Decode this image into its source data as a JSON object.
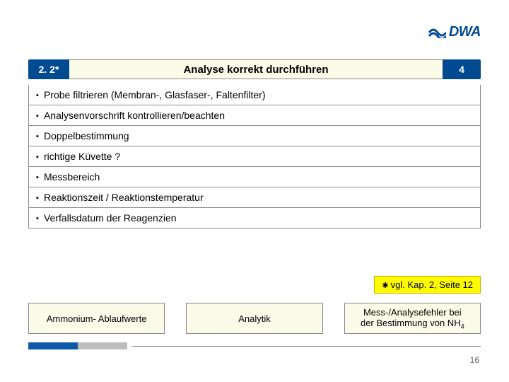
{
  "logo_text": "DWA",
  "header": {
    "tag_left": "2. 2*",
    "title": "Analyse korrekt durchführen",
    "tag_right": "4"
  },
  "bullets": [
    "Probe filtrieren (Membran-, Glasfaser-, Faltenfilter)",
    "Analysenvorschrift kontrollieren/beachten",
    "Doppelbestimmung",
    "richtige Küvette ?",
    "Messbereich",
    "Reaktionszeit / Reaktionstemperatur",
    "Verfallsdatum der Reagenzien"
  ],
  "reference_note": "vgl. Kap. 2, Seite 12",
  "bottom_boxes": {
    "b1": "Ammonium- Ablaufwerte",
    "b2": "Analytik",
    "b3_line1": "Mess-/Analysefehler bei",
    "b3_line2": "der Bestimmung von NH",
    "b3_sub": "4"
  },
  "page_number": "16"
}
